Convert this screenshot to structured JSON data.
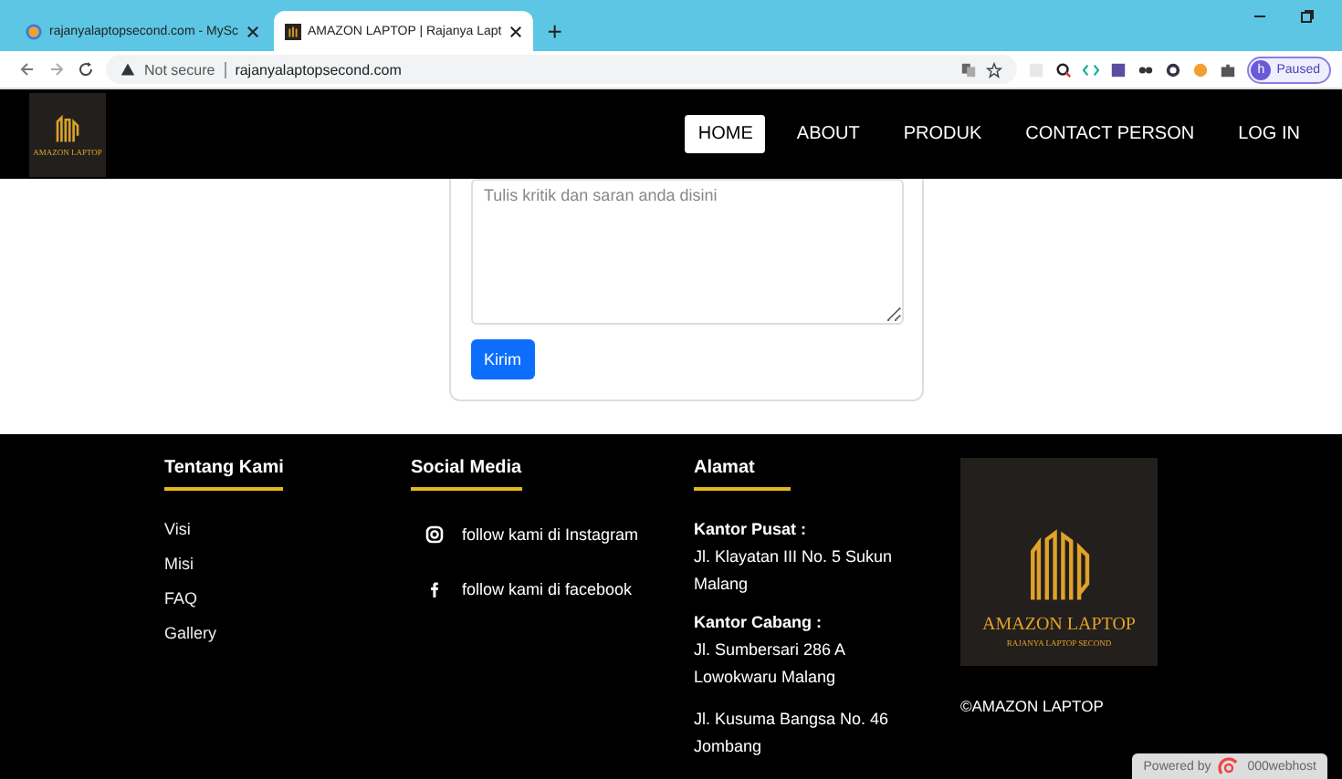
{
  "browser": {
    "tabs": [
      {
        "title": "rajanyalaptopsecond.com - MySc",
        "selected": false
      },
      {
        "title": "AMAZON LAPTOP | Rajanya Lapt",
        "selected": true
      }
    ],
    "new_tab": "+",
    "address": {
      "security": "Not secure",
      "url": "rajanyalaptopsecond.com"
    },
    "profile": {
      "initial": "h",
      "status": "Paused"
    }
  },
  "nav": {
    "brand": {
      "name": "AMAZON LAPTOP"
    },
    "items": [
      {
        "label": "HOME",
        "selected": true
      },
      {
        "label": "ABOUT",
        "selected": false
      },
      {
        "label": "PRODUK",
        "selected": false
      },
      {
        "label": "CONTACT PERSON",
        "selected": false
      },
      {
        "label": "LOG IN",
        "selected": false
      }
    ]
  },
  "form": {
    "placeholder": "Tulis kritik dan saran anda disini",
    "submit": "Kirim"
  },
  "footer": {
    "about": {
      "heading": "Tentang Kami",
      "links": [
        "Visi",
        "Misi",
        "FAQ",
        "Gallery"
      ]
    },
    "social": {
      "heading": "Social Media",
      "items": [
        {
          "kind": "instagram",
          "label": "follow kami di Instagram"
        },
        {
          "kind": "facebook",
          "label": "follow kami di facebook"
        }
      ]
    },
    "address": {
      "heading": "Alamat",
      "blocks": [
        {
          "title": "Kantor Pusat :",
          "text": "Jl. Klayatan III No. 5 Sukun Malang"
        },
        {
          "title": "Kantor Cabang :",
          "text": "Jl. Sumbersari 286 A Lowokwaru Malang"
        },
        {
          "text": "Jl. Kusuma Bangsa No. 46 Jombang"
        }
      ]
    },
    "brand_card": {
      "name": "AMAZON LAPTOP",
      "tagline": "RAJANYA LAPTOP SECOND"
    },
    "copyright": "©AMAZON LAPTOP"
  },
  "hosting_badge": {
    "prefix": "Powered by",
    "name": "000webhost"
  }
}
